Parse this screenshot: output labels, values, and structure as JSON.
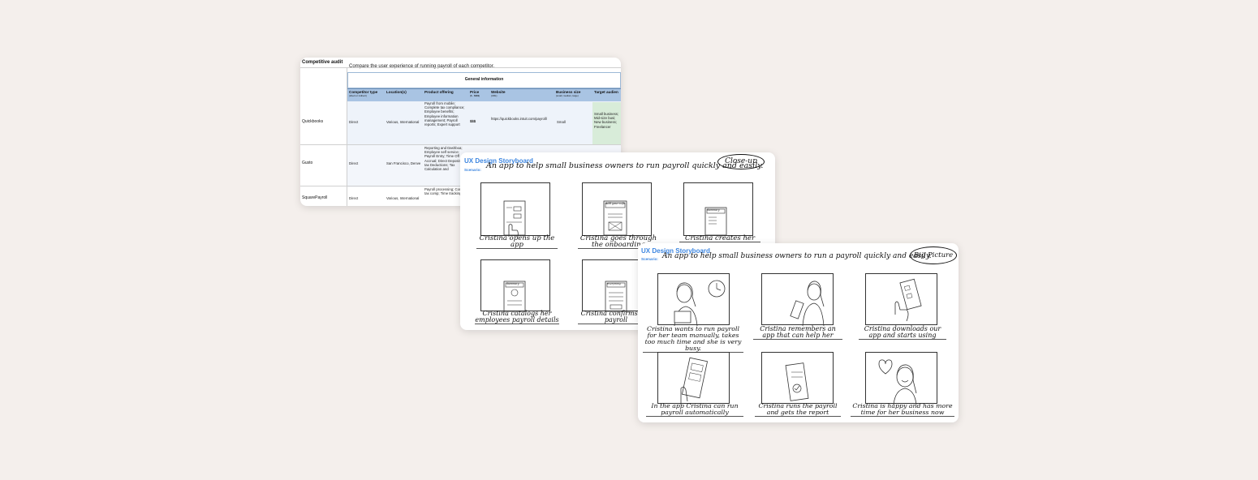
{
  "audit": {
    "title": "Competitive audit",
    "subtitle": "Compare the user experience of running payroll of each competitor.",
    "group_header": "General information",
    "columns": [
      {
        "label": "Competitor type",
        "sub": "(direct or indirect)"
      },
      {
        "label": "Location(s)",
        "sub": ""
      },
      {
        "label": "Product offering",
        "sub": ""
      },
      {
        "label": "Price",
        "sub": "($ - $$$$)"
      },
      {
        "label": "Website",
        "sub": "(URL)"
      },
      {
        "label": "Business size",
        "sub": "(small, medium, large)"
      },
      {
        "label": "Target audien",
        "sub": ""
      }
    ],
    "rows": [
      {
        "name": "Quickbooks",
        "type": "Direct",
        "location": "Various, International",
        "offering": "Payroll from mobile; Complete tax compliance; Employee benefits; Employee information management; Payroll reports; Expert support",
        "price": "$$$",
        "website": "https://quickbooks.intuit.com/payroll/",
        "size": "Small",
        "audience": "Small business; Mid-size busi; New business; Freelancer"
      },
      {
        "name": "Gusto",
        "type": "Direct",
        "location": "San Francisco, Denve",
        "offering": "Reporting and Dashboa; Employee self service; Payroll Entry; Time Off Accrual; Direct Deposit; Pre-tax Deductions; Tax Calculation and",
        "price": "",
        "website": "",
        "size": "",
        "audience": ""
      },
      {
        "name": "SquarePayroll",
        "type": "Direct",
        "location": "Various, International",
        "offering": "Payroll processing; Complete tax comp; Time tracking",
        "price": "",
        "website": "",
        "size": "",
        "audience": ""
      }
    ]
  },
  "storyboard_closeup": {
    "title": "UX Design Storyboard",
    "scenario_label": "Scenario:",
    "scenario_text": "An app to help small business owners to run payroll quickly and easily.",
    "type_label": "Close-up",
    "screen_labels": [
      "Add your info",
      "Summary",
      "Summary",
      "Everything"
    ],
    "captions": [
      "Cristina opens up the app",
      "Cristina goes through the onboarding",
      "Cristina creates her",
      "Cristina catalogs her employees payroll details",
      "Cristina confirms run payroll"
    ]
  },
  "storyboard_bigpicture": {
    "title": "UX Design Storyboard",
    "scenario_label": "Scenario:",
    "scenario_text": "An app to help small business owners to run a payroll quickly and easily.",
    "type_label": "Big Picture",
    "captions": [
      "Cristina wants to run payroll for her team manually, takes too much time and she is very busy.",
      "Cristina remembers an app that can help her",
      "Cristina downloads our app and starts using",
      "In the app Cristina can run payroll automatically",
      "Cristina runs the payroll and gets the report",
      "Cristina is happy and has more time for her business now"
    ]
  }
}
